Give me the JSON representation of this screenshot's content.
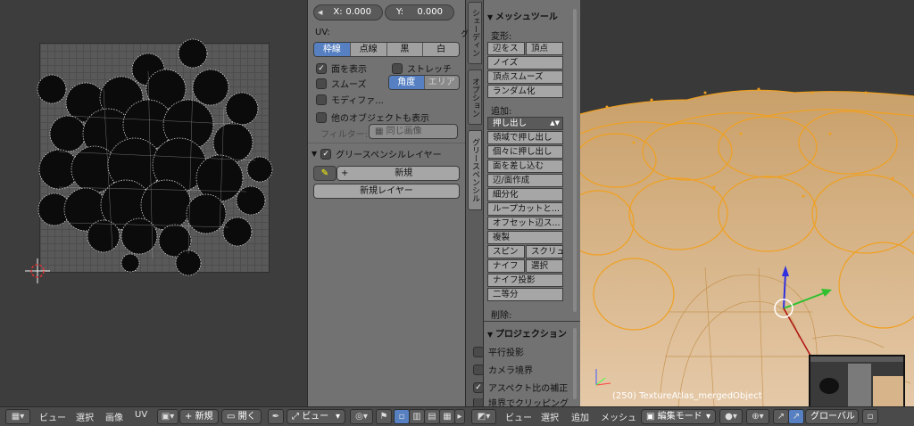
{
  "uv_editor": {
    "header": {
      "menus": [
        "ビュー",
        "選択",
        "画像",
        "UV"
      ],
      "new_label": "新規",
      "open_label": "開く",
      "view_select": "ビュー"
    }
  },
  "properties": {
    "x_label": "X:",
    "x_value": "0.000",
    "y_label": "Y:",
    "y_value": "0.000",
    "uv_label": "UV:",
    "uv_modes": [
      "枠線",
      "点線",
      "黒",
      "白"
    ],
    "uv_mode_active": "枠線",
    "checks": {
      "show_faces": "面を表示",
      "stretch": "ストレッチ",
      "smooth": "スムーズ",
      "modifier": "モディファ...",
      "other_objects": "他のオブジェクトも表示"
    },
    "stretch_modes": [
      "角度",
      "エリア"
    ],
    "filter_label": "フィルター:",
    "filter_value": "同じ画像",
    "grease_panel_title": "グリースペンシルレイヤー",
    "grease_new": "新規",
    "grease_new_layer": "新規レイヤー"
  },
  "tool_tabs": [
    "シェーディング",
    "オプション",
    "グリースペンシル"
  ],
  "mesh_tools": {
    "title": "メッシュツール",
    "deform_label": "変形:",
    "deform": [
      "辺をス",
      "頂点",
      "ノイズ",
      "頂点スムーズ",
      "ランダム化"
    ],
    "add_label": "追加:",
    "extrude": "押し出し",
    "add": [
      "領域で押し出し",
      "個々に押し出し",
      "面を差し込む",
      "辺/面作成",
      "細分化",
      "ループカットと...",
      "オフセット辺ス...",
      "複製",
      "スピン",
      "スクリュ",
      "ナイフ",
      "選択",
      "ナイフ投影",
      "二等分"
    ],
    "delete_label": "削除:"
  },
  "projection": {
    "title": "プロジェクション",
    "options": [
      "平行投影",
      "カメラ境界",
      "アスペクト比の補正",
      "境界でクリッピング"
    ]
  },
  "viewport": {
    "info": "(250) TextureAtlas_mergedObject",
    "header": {
      "menus": [
        "ビュー",
        "選択",
        "追加",
        "メッシュ"
      ],
      "mode": "編集モード",
      "orientation": "グローバル"
    },
    "colors": {
      "selection": "#f0a020",
      "mesh": "#d7b48a"
    }
  }
}
